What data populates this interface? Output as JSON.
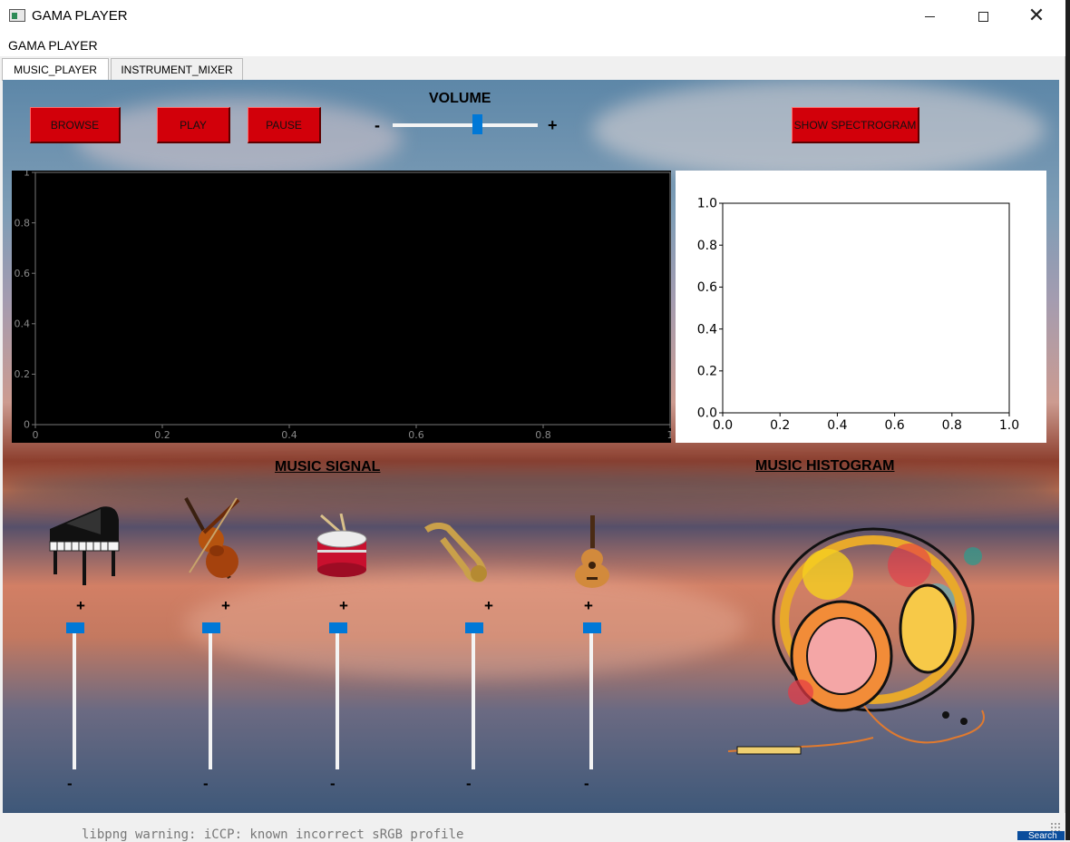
{
  "window": {
    "title": "GAMA PLAYER"
  },
  "menu": {
    "title": "GAMA PLAYER"
  },
  "tabs": [
    {
      "label": "MUSIC_PLAYER",
      "active": true
    },
    {
      "label": "INSTRUMENT_MIXER",
      "active": false
    }
  ],
  "controls": {
    "browse_label": "BROWSE",
    "play_label": "PLAY",
    "pause_label": "PAUSE",
    "spectrogram_label": "SHOW SPECTROGRAM",
    "volume_label": "VOLUME",
    "volume_minus": "-",
    "volume_plus": "+",
    "volume_value": 0.59
  },
  "sections": {
    "signal_label": "MUSIC SIGNAL",
    "histogram_label": "MUSIC HISTOGRAM"
  },
  "mixer": {
    "plus": "+",
    "minus": "-",
    "instruments": [
      {
        "name": "piano",
        "icon": "piano-icon",
        "level": 1.0
      },
      {
        "name": "violin",
        "icon": "violin-icon",
        "level": 1.0
      },
      {
        "name": "drum",
        "icon": "drum-icon",
        "level": 1.0
      },
      {
        "name": "saxophone",
        "icon": "saxophone-icon",
        "level": 1.0
      },
      {
        "name": "guitar",
        "icon": "guitar-icon",
        "level": 1.0
      }
    ]
  },
  "chart_data": [
    {
      "type": "line",
      "title": "",
      "xlabel": "",
      "ylabel": "",
      "xlim": [
        0,
        1
      ],
      "ylim": [
        0,
        1
      ],
      "x_ticks": [
        "0",
        "0.2",
        "0.4",
        "0.6",
        "0.8",
        "1"
      ],
      "y_ticks": [
        "0",
        "0.2",
        "0.4",
        "0.6",
        "0.8",
        "1"
      ],
      "series": [],
      "background": "#000000",
      "grid": false
    },
    {
      "type": "bar",
      "title": "",
      "xlabel": "",
      "ylabel": "",
      "xlim": [
        0,
        1
      ],
      "ylim": [
        0,
        1
      ],
      "x_ticks": [
        "0.0",
        "0.2",
        "0.4",
        "0.6",
        "0.8",
        "1.0"
      ],
      "y_ticks": [
        "0.0",
        "0.2",
        "0.4",
        "0.6",
        "0.8",
        "1.0"
      ],
      "series": [],
      "background": "#ffffff",
      "grid": false
    }
  ],
  "terminal": {
    "text": "libpng warning: iCCP: known incorrect sRGB profile"
  },
  "taskbar": {
    "search": "Search"
  },
  "colors": {
    "button_red": "#d2000a",
    "slider_blue": "#0078d7"
  }
}
